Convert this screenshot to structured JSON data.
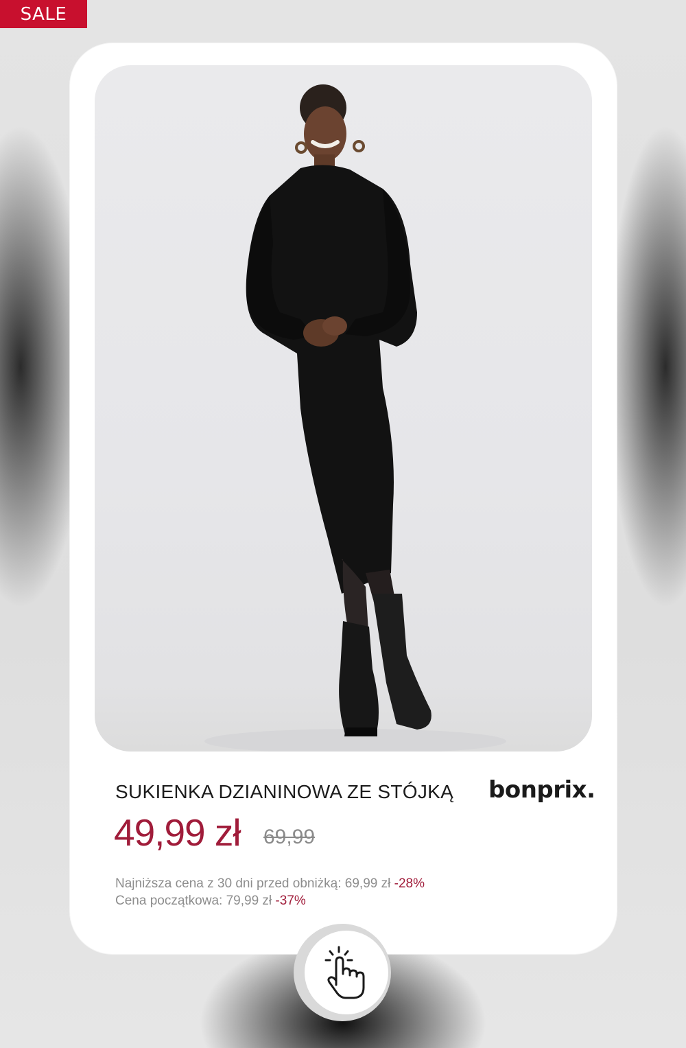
{
  "badge": {
    "label": "SALE"
  },
  "product": {
    "title": "SUKIENKA DZIANINOWA ZE STÓJKĄ",
    "brand": "bonprix.",
    "price": "49,99 zł",
    "old_price": "69,99",
    "lowest_price_label": "Najniższa cena z 30 dni  przed obniżką: 69,99 zł",
    "lowest_price_discount": "-28%",
    "initial_price_label": "Cena początkowa: 79,99 zł",
    "initial_price_discount": "-37%"
  },
  "icons": {
    "tap": "hand-tap-icon"
  },
  "colors": {
    "accent": "#a01c3a",
    "badge": "#c8102e"
  }
}
